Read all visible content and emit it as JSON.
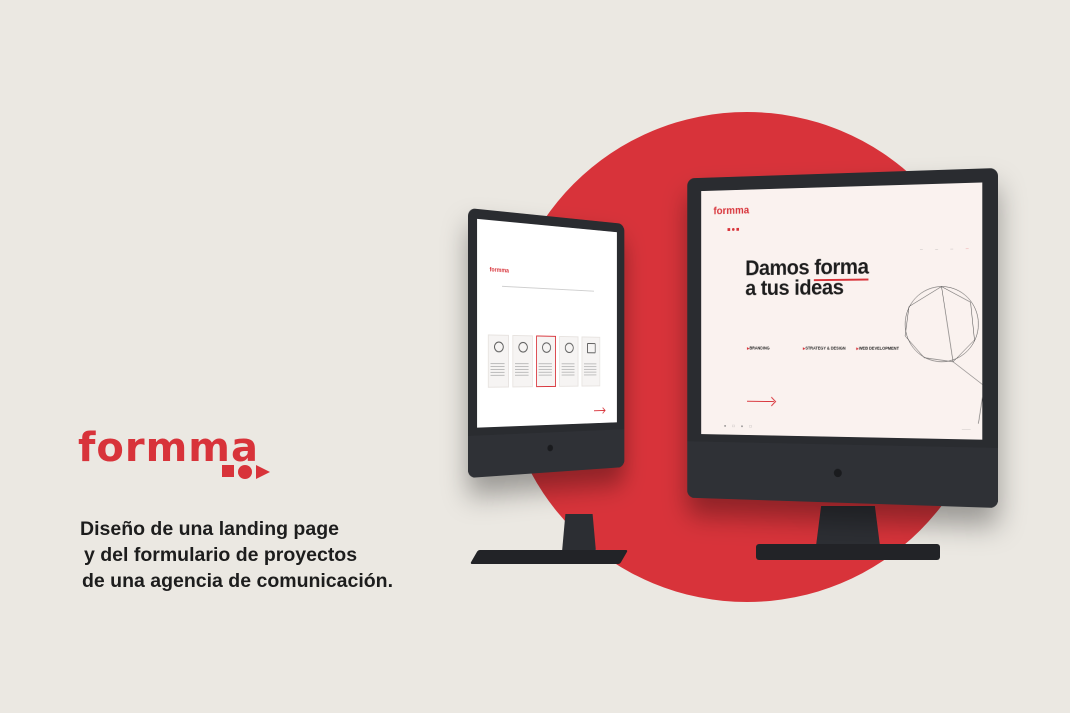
{
  "colors": {
    "background": "#ebe8e2",
    "accent": "#d8333a",
    "monitor": "#2a2c30"
  },
  "brand": {
    "logo_text": "formma"
  },
  "tagline": [
    "Diseño de una landing page",
    "y del formulario de proyectos",
    "de una agencia de comunicación."
  ],
  "big_screen": {
    "logo": "formma",
    "hero_line1": "Damos",
    "hero_highlight": "forma",
    "hero_line2": "a tus ideas",
    "services": [
      {
        "title": "BRANDING"
      },
      {
        "title": "STRATEGY & DESIGN"
      },
      {
        "title": "WEB DEVELOPMENT"
      }
    ]
  },
  "small_screen": {
    "logo": "formma",
    "cards": [
      {
        "icon": "brand-icon"
      },
      {
        "icon": "strategy-icon"
      },
      {
        "icon": "design-icon"
      },
      {
        "icon": "marketing-icon"
      },
      {
        "icon": "web-icon"
      }
    ]
  },
  "icons": [
    "apple-icon",
    "arrow-right-icon",
    "twitter-icon",
    "instagram-icon",
    "facebook-icon",
    "linkedin-icon"
  ]
}
